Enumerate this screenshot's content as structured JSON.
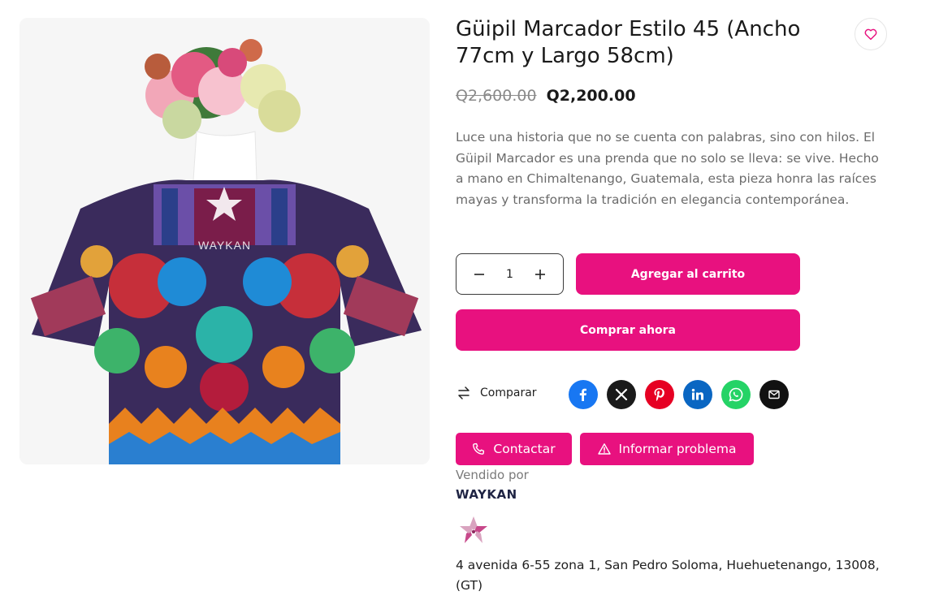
{
  "product": {
    "title": "Güipil Marcador Estilo 45 (Ancho 77cm y Largo 58cm)",
    "old_price": "Q2,600.00",
    "price": "Q2,200.00",
    "description": "Luce una historia que no se cuenta con palabras, sino con hilos. El Güipil Marcador es una prenda que no solo se lleva: se vive. Hecho a mano en Chimaltenango, Guatemala, esta pieza honra las raíces mayas y transforma la tradición en elegancia contemporánea.",
    "image_watermark": "WAYKAN",
    "wishlist_icon": "heart-icon"
  },
  "purchase": {
    "quantity": "1",
    "add_to_cart_label": "Agregar al carrito",
    "buy_now_label": "Comprar ahora"
  },
  "compare_label": "Comparar",
  "share": [
    {
      "name": "facebook",
      "icon": "facebook-icon",
      "color": "#1877f2"
    },
    {
      "name": "x",
      "icon": "x-icon",
      "color": "#1a1a1a"
    },
    {
      "name": "pinterest",
      "icon": "pinterest-icon",
      "color": "#e60023"
    },
    {
      "name": "linkedin",
      "icon": "linkedin-icon",
      "color": "#0a66c2"
    },
    {
      "name": "whatsapp",
      "icon": "whatsapp-icon",
      "color": "#25d366"
    },
    {
      "name": "email",
      "icon": "email-icon",
      "color": "#111111"
    }
  ],
  "actions": {
    "contact_label": "Contactar",
    "report_label": "Informar problema"
  },
  "vendor": {
    "sold_by_label": "Vendido por",
    "name": "WAYKAN",
    "address": "4 avenida 6-55 zona 1, San Pedro Soloma, Huehuetenango, 13008, (GT)"
  },
  "colors": {
    "accent": "#e8117f",
    "text": "#1a1a1a",
    "muted": "#6b6b6b"
  }
}
